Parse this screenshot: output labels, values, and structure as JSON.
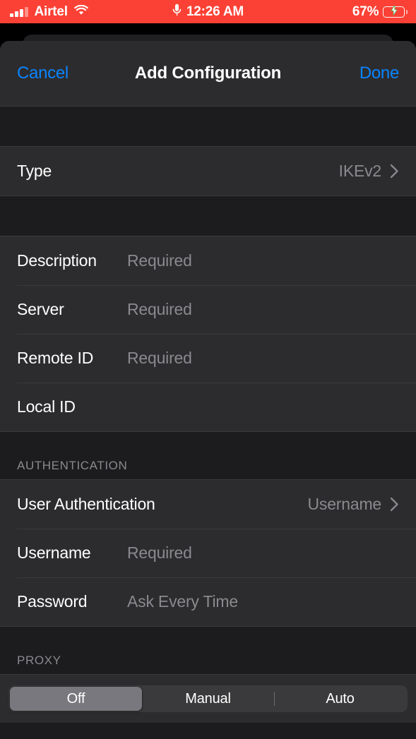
{
  "status_bar": {
    "carrier": "Airtel",
    "signal_icon": "signal-bars-icon",
    "wifi_icon": "wifi-icon",
    "mic_icon": "microphone-icon",
    "time": "12:26 AM",
    "battery_percent": "67%",
    "battery_level": 67,
    "battery_charging": true,
    "background_color": "#FB4135",
    "battery_fill_color": "#35C759"
  },
  "nav_bar": {
    "cancel_label": "Cancel",
    "title": "Add Configuration",
    "done_label": "Done",
    "accent_color": "#0A84FF"
  },
  "type_section": {
    "rows": [
      {
        "label": "Type",
        "value": "IKEv2",
        "accessory": "chevron-right-icon"
      }
    ]
  },
  "details_section": {
    "rows": [
      {
        "label": "Description",
        "placeholder": "Required",
        "value": ""
      },
      {
        "label": "Server",
        "placeholder": "Required",
        "value": ""
      },
      {
        "label": "Remote ID",
        "placeholder": "Required",
        "value": ""
      },
      {
        "label": "Local ID",
        "placeholder": "",
        "value": ""
      }
    ]
  },
  "authentication_section": {
    "header": "AUTHENTICATION",
    "rows": [
      {
        "label": "User Authentication",
        "value": "Username",
        "accessory": "chevron-right-icon"
      },
      {
        "label": "Username",
        "placeholder": "Required",
        "value": ""
      },
      {
        "label": "Password",
        "placeholder": "Ask Every Time",
        "value": ""
      }
    ]
  },
  "proxy_section": {
    "header": "PROXY",
    "segments": [
      {
        "label": "Off",
        "selected": true
      },
      {
        "label": "Manual",
        "selected": false
      },
      {
        "label": "Auto",
        "selected": false
      }
    ],
    "selected_index": 0
  }
}
